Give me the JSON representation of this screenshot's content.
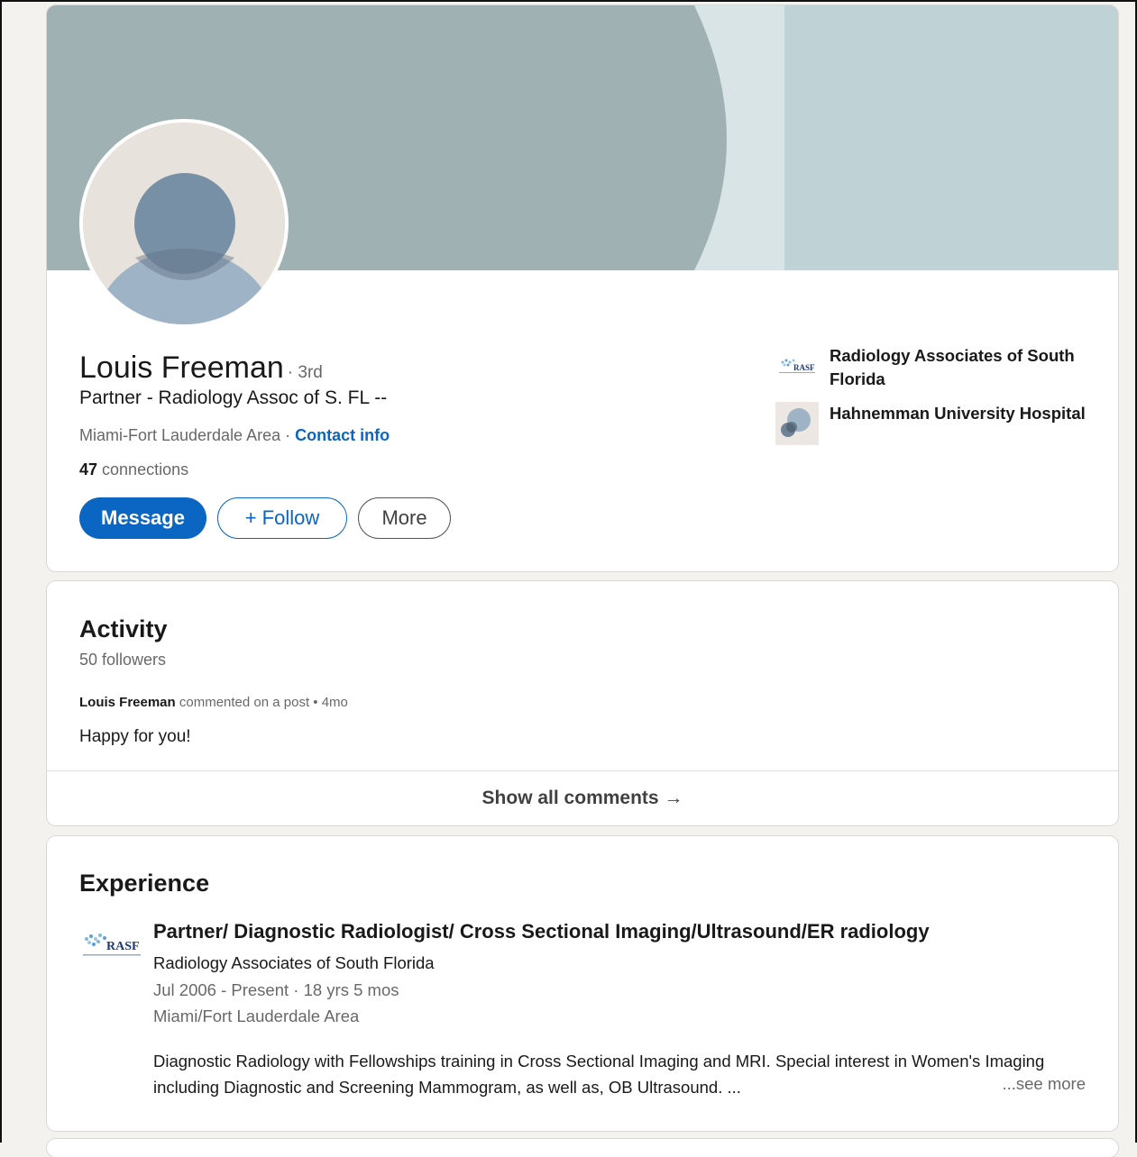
{
  "profile": {
    "name": "Louis Freeman",
    "degree": "· 3rd",
    "headline": "Partner - Radiology Assoc of S. FL --",
    "location": "Miami-Fort Lauderdale Area",
    "location_sep": " · ",
    "contact_info": "Contact info",
    "connections_count": "47",
    "connections_label": " connections",
    "buttons": {
      "message": "Message",
      "follow": "+ Follow",
      "more": "More"
    }
  },
  "side_orgs": [
    {
      "name": "Radiology Associates of South Florida",
      "logo": "rasf-logo"
    },
    {
      "name": "Hahnemman University Hospital",
      "logo": "hospital-logo"
    }
  ],
  "activity": {
    "title": "Activity",
    "followers": "50 followers",
    "post_author": "Louis Freeman",
    "post_action": " commented on a post • 4mo",
    "comment": "Happy for you!",
    "show_all": "Show all comments →"
  },
  "experience": {
    "title": "Experience",
    "items": [
      {
        "role": "Partner/ Diagnostic Radiologist/ Cross Sectional Imaging/Ultrasound/ER radiology",
        "company": "Radiology Associates of South Florida",
        "dates": "Jul 2006 - Present · 18 yrs 5 mos",
        "location": "Miami/Fort Lauderdale Area",
        "description": "Diagnostic Radiology with Fellowships training in Cross Sectional Imaging and MRI. Special interest in Women's Imaging including Diagnostic and Screening Mammogram, as well as, OB Ultrasound. ...",
        "see_more": "...see more",
        "logo_text": "RASF"
      }
    ]
  },
  "colors": {
    "accent": "#0a66c2",
    "page_bg": "#f4f2ee"
  }
}
